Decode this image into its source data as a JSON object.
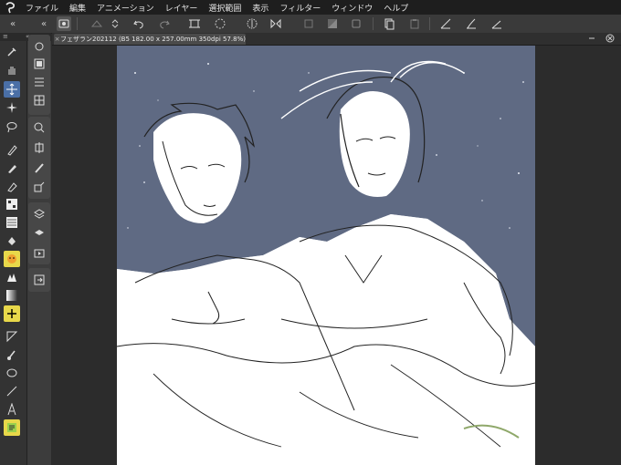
{
  "menubar": {
    "items": [
      {
        "label": "ファイル"
      },
      {
        "label": "編集"
      },
      {
        "label": "アニメーション"
      },
      {
        "label": "レイヤー"
      },
      {
        "label": "選択範囲"
      },
      {
        "label": "表示"
      },
      {
        "label": "フィルター"
      },
      {
        "label": "ウィンドウ"
      },
      {
        "label": "ヘルプ"
      }
    ]
  },
  "document": {
    "tab_label": "フェザラン202112 (B5 182.00 x 257.00mm 350dpi 57.8%)",
    "close_glyph": "×"
  },
  "panel": {
    "collapse_left": "≡",
    "collapse_right": "«",
    "collapse_far": "«"
  },
  "colors": {
    "accent": "#4a6fa6",
    "highlight_yellow": "#e8d84a",
    "sky": "#5f6a83",
    "canvas_bg": "#ffffff"
  },
  "icons": {
    "toolbar": [
      "app-logo-icon",
      "navigator-icon",
      "fill-icon",
      "stepper-icon",
      "undo-icon",
      "redo-icon",
      "transform-icon",
      "spinner-icon",
      "lasso-icon",
      "flip-icon",
      "crop-icon",
      "mask-icon",
      "layer-icon",
      "copy-icon",
      "paste-icon",
      "ruler-icon",
      "brush-icon",
      "angle-icon"
    ],
    "tools": [
      "eyedropper-icon",
      "hand-icon",
      "move-icon",
      "sparkle-icon",
      "lasso-icon",
      "pen-icon",
      "brush-icon",
      "eraser-icon",
      "halftone-icon",
      "pattern-icon",
      "bucket-icon",
      "emoji-icon",
      "ink-icon",
      "gradient-icon",
      "plus-icon",
      "triangle-icon",
      "brush-small-icon",
      "ellipse-icon",
      "line-icon",
      "text-icon",
      "note-icon"
    ]
  }
}
